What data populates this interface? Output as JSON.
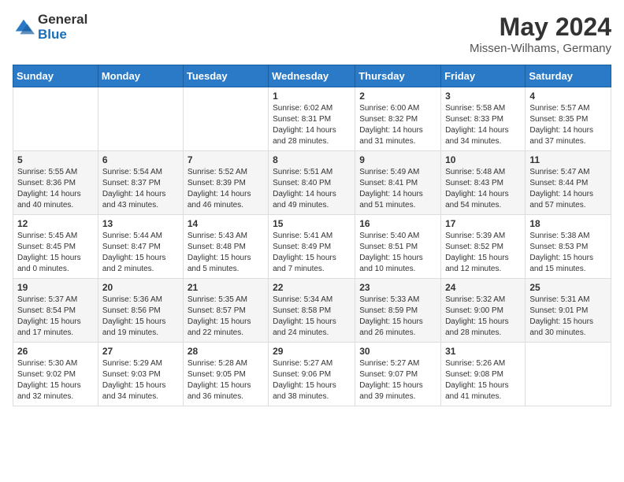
{
  "header": {
    "logo_general": "General",
    "logo_blue": "Blue",
    "month_year": "May 2024",
    "location": "Missen-Wilhams, Germany"
  },
  "weekdays": [
    "Sunday",
    "Monday",
    "Tuesday",
    "Wednesday",
    "Thursday",
    "Friday",
    "Saturday"
  ],
  "weeks": [
    [
      {
        "day": "",
        "info": ""
      },
      {
        "day": "",
        "info": ""
      },
      {
        "day": "",
        "info": ""
      },
      {
        "day": "1",
        "info": "Sunrise: 6:02 AM\nSunset: 8:31 PM\nDaylight: 14 hours\nand 28 minutes."
      },
      {
        "day": "2",
        "info": "Sunrise: 6:00 AM\nSunset: 8:32 PM\nDaylight: 14 hours\nand 31 minutes."
      },
      {
        "day": "3",
        "info": "Sunrise: 5:58 AM\nSunset: 8:33 PM\nDaylight: 14 hours\nand 34 minutes."
      },
      {
        "day": "4",
        "info": "Sunrise: 5:57 AM\nSunset: 8:35 PM\nDaylight: 14 hours\nand 37 minutes."
      }
    ],
    [
      {
        "day": "5",
        "info": "Sunrise: 5:55 AM\nSunset: 8:36 PM\nDaylight: 14 hours\nand 40 minutes."
      },
      {
        "day": "6",
        "info": "Sunrise: 5:54 AM\nSunset: 8:37 PM\nDaylight: 14 hours\nand 43 minutes."
      },
      {
        "day": "7",
        "info": "Sunrise: 5:52 AM\nSunset: 8:39 PM\nDaylight: 14 hours\nand 46 minutes."
      },
      {
        "day": "8",
        "info": "Sunrise: 5:51 AM\nSunset: 8:40 PM\nDaylight: 14 hours\nand 49 minutes."
      },
      {
        "day": "9",
        "info": "Sunrise: 5:49 AM\nSunset: 8:41 PM\nDaylight: 14 hours\nand 51 minutes."
      },
      {
        "day": "10",
        "info": "Sunrise: 5:48 AM\nSunset: 8:43 PM\nDaylight: 14 hours\nand 54 minutes."
      },
      {
        "day": "11",
        "info": "Sunrise: 5:47 AM\nSunset: 8:44 PM\nDaylight: 14 hours\nand 57 minutes."
      }
    ],
    [
      {
        "day": "12",
        "info": "Sunrise: 5:45 AM\nSunset: 8:45 PM\nDaylight: 15 hours\nand 0 minutes."
      },
      {
        "day": "13",
        "info": "Sunrise: 5:44 AM\nSunset: 8:47 PM\nDaylight: 15 hours\nand 2 minutes."
      },
      {
        "day": "14",
        "info": "Sunrise: 5:43 AM\nSunset: 8:48 PM\nDaylight: 15 hours\nand 5 minutes."
      },
      {
        "day": "15",
        "info": "Sunrise: 5:41 AM\nSunset: 8:49 PM\nDaylight: 15 hours\nand 7 minutes."
      },
      {
        "day": "16",
        "info": "Sunrise: 5:40 AM\nSunset: 8:51 PM\nDaylight: 15 hours\nand 10 minutes."
      },
      {
        "day": "17",
        "info": "Sunrise: 5:39 AM\nSunset: 8:52 PM\nDaylight: 15 hours\nand 12 minutes."
      },
      {
        "day": "18",
        "info": "Sunrise: 5:38 AM\nSunset: 8:53 PM\nDaylight: 15 hours\nand 15 minutes."
      }
    ],
    [
      {
        "day": "19",
        "info": "Sunrise: 5:37 AM\nSunset: 8:54 PM\nDaylight: 15 hours\nand 17 minutes."
      },
      {
        "day": "20",
        "info": "Sunrise: 5:36 AM\nSunset: 8:56 PM\nDaylight: 15 hours\nand 19 minutes."
      },
      {
        "day": "21",
        "info": "Sunrise: 5:35 AM\nSunset: 8:57 PM\nDaylight: 15 hours\nand 22 minutes."
      },
      {
        "day": "22",
        "info": "Sunrise: 5:34 AM\nSunset: 8:58 PM\nDaylight: 15 hours\nand 24 minutes."
      },
      {
        "day": "23",
        "info": "Sunrise: 5:33 AM\nSunset: 8:59 PM\nDaylight: 15 hours\nand 26 minutes."
      },
      {
        "day": "24",
        "info": "Sunrise: 5:32 AM\nSunset: 9:00 PM\nDaylight: 15 hours\nand 28 minutes."
      },
      {
        "day": "25",
        "info": "Sunrise: 5:31 AM\nSunset: 9:01 PM\nDaylight: 15 hours\nand 30 minutes."
      }
    ],
    [
      {
        "day": "26",
        "info": "Sunrise: 5:30 AM\nSunset: 9:02 PM\nDaylight: 15 hours\nand 32 minutes."
      },
      {
        "day": "27",
        "info": "Sunrise: 5:29 AM\nSunset: 9:03 PM\nDaylight: 15 hours\nand 34 minutes."
      },
      {
        "day": "28",
        "info": "Sunrise: 5:28 AM\nSunset: 9:05 PM\nDaylight: 15 hours\nand 36 minutes."
      },
      {
        "day": "29",
        "info": "Sunrise: 5:27 AM\nSunset: 9:06 PM\nDaylight: 15 hours\nand 38 minutes."
      },
      {
        "day": "30",
        "info": "Sunrise: 5:27 AM\nSunset: 9:07 PM\nDaylight: 15 hours\nand 39 minutes."
      },
      {
        "day": "31",
        "info": "Sunrise: 5:26 AM\nSunset: 9:08 PM\nDaylight: 15 hours\nand 41 minutes."
      },
      {
        "day": "",
        "info": ""
      }
    ]
  ]
}
